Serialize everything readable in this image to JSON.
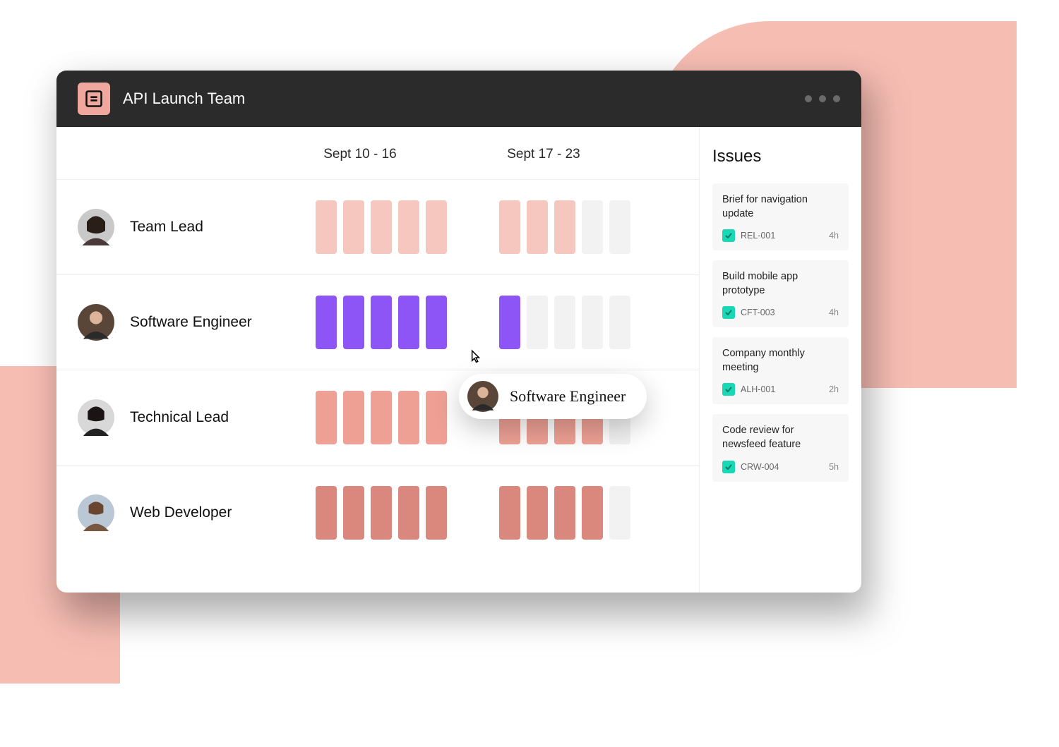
{
  "header": {
    "title": "API Launch Team"
  },
  "timeline": {
    "weeks": [
      "Sept 10 - 16",
      "Sept 17 - 23"
    ]
  },
  "roles": [
    {
      "name": "Team Lead",
      "color": "#f5c7bf",
      "week1_fill": [
        1,
        1,
        1,
        1,
        1
      ],
      "week2_fill": [
        1,
        1,
        1,
        0,
        0
      ]
    },
    {
      "name": "Software Engineer",
      "color": "#8d55f6",
      "week1_fill": [
        1,
        1,
        1,
        1,
        1
      ],
      "week2_fill": [
        1,
        0,
        0,
        0,
        0
      ]
    },
    {
      "name": "Technical Lead",
      "color": "#eea094",
      "week1_fill": [
        1,
        1,
        1,
        1,
        1
      ],
      "week2_fill": [
        1,
        1,
        1,
        1,
        0
      ]
    },
    {
      "name": "Web Developer",
      "color": "#da887e",
      "week1_fill": [
        1,
        1,
        1,
        1,
        1
      ],
      "week2_fill": [
        1,
        1,
        1,
        1,
        0
      ]
    }
  ],
  "tooltip": {
    "label": "Software Engineer"
  },
  "sidebar": {
    "title": "Issues",
    "issues": [
      {
        "title": "Brief for navigation update",
        "code": "REL-001",
        "hours": "4h"
      },
      {
        "title": "Build mobile app prototype",
        "code": "CFT-003",
        "hours": "4h"
      },
      {
        "title": "Company monthly meeting",
        "code": "ALH-001",
        "hours": "2h"
      },
      {
        "title": "Code review for newsfeed feature",
        "code": "CRW-004",
        "hours": "5h"
      }
    ]
  },
  "colors": {
    "empty_bar": "#f2f2f2"
  }
}
